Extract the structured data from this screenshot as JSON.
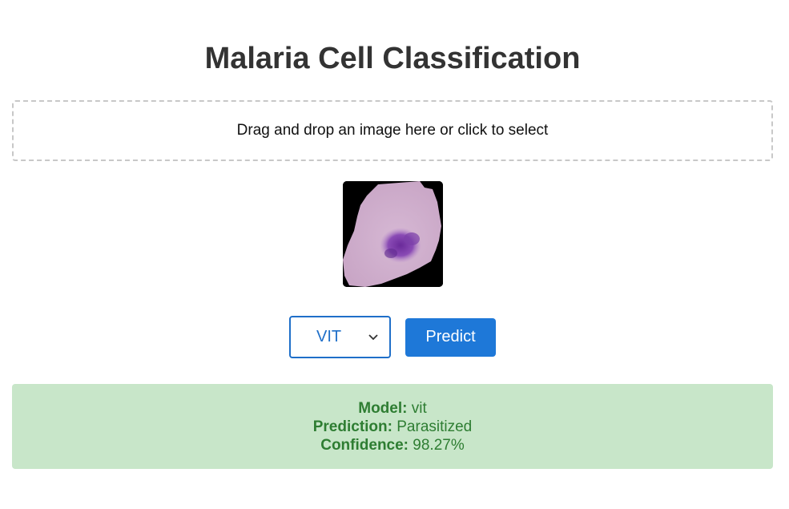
{
  "page": {
    "title": "Malaria Cell Classification"
  },
  "upload": {
    "prompt": "Drag and drop an image here or click to select"
  },
  "controls": {
    "model_select": {
      "selected": "VIT"
    },
    "predict_label": "Predict"
  },
  "result": {
    "model_label": "Model:",
    "model_value": "vit",
    "prediction_label": "Prediction:",
    "prediction_value": "Parasitized",
    "confidence_label": "Confidence:",
    "confidence_value": "98.27%"
  },
  "colors": {
    "accent": "#1e78d8",
    "result_bg": "#c8e6c9",
    "result_text": "#2e7d32",
    "title_text": "#333333"
  },
  "icons": {
    "select_arrow": "chevron-down-icon"
  }
}
